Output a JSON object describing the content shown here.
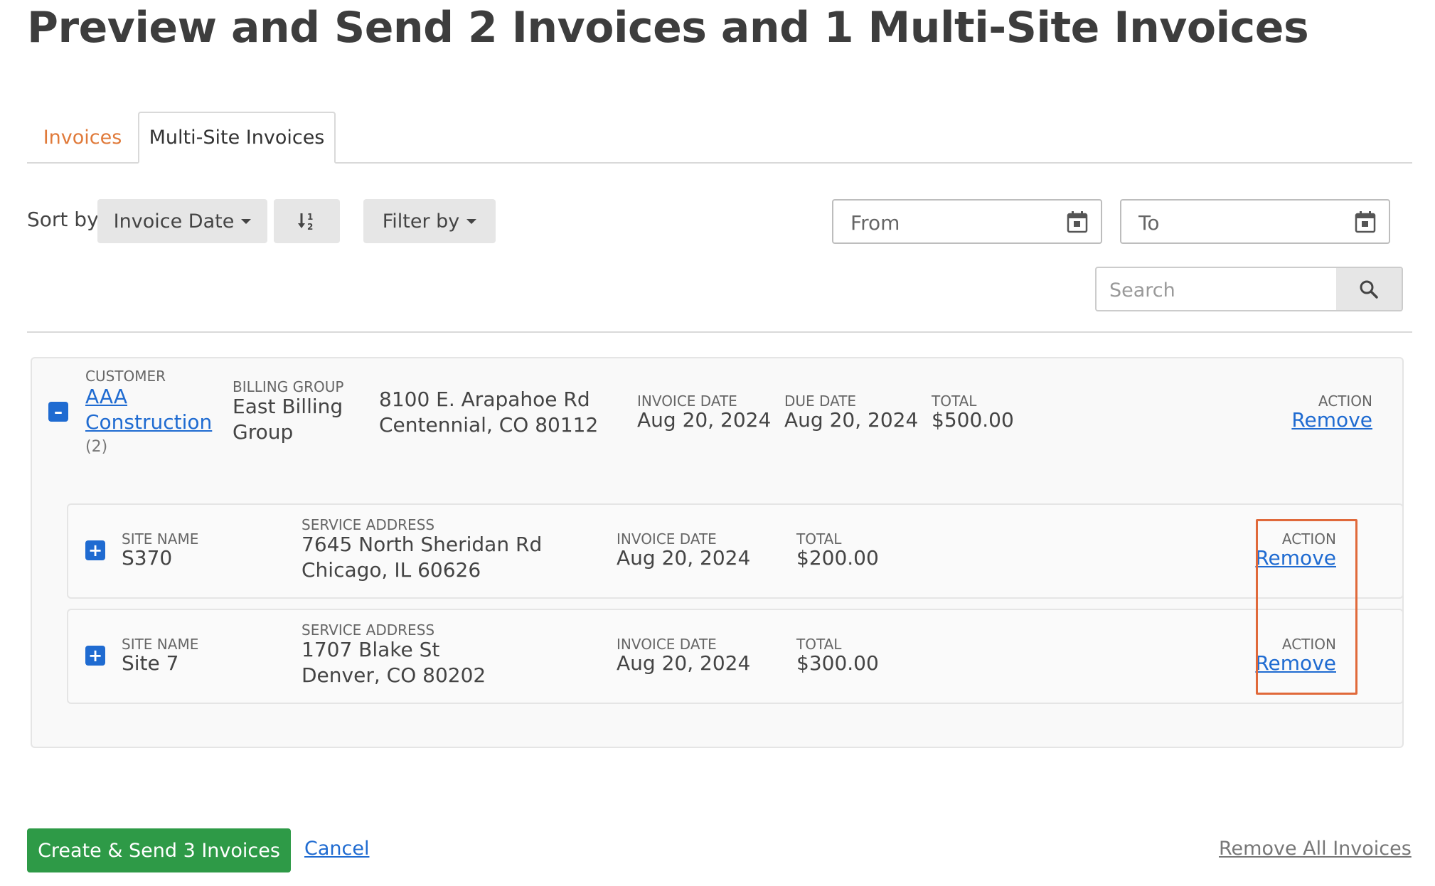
{
  "page": {
    "title": "Preview and Send 2 Invoices and 1 Multi-Site Invoices"
  },
  "tabs": [
    {
      "label": "Invoices",
      "active": false
    },
    {
      "label": "Multi-Site Invoices",
      "active": true
    }
  ],
  "toolbar": {
    "sort_label": "Sort by",
    "sort_value": "Invoice Date",
    "filter_label": "Filter by",
    "from_placeholder": "From",
    "to_placeholder": "To",
    "search_placeholder": "Search"
  },
  "customer": {
    "labels": {
      "customer": "CUSTOMER",
      "billing_group": "BILLING GROUP",
      "invoice_date": "INVOICE DATE",
      "due_date": "DUE DATE",
      "total": "TOTAL",
      "action": "ACTION"
    },
    "name_line1": "AAA",
    "name_line2": "Construction",
    "count": "(2)",
    "billing_group_line1": "East Billing",
    "billing_group_line2": "Group",
    "address_line1": "8100 E. Arapahoe Rd",
    "address_line2": "Centennial, CO 80112",
    "invoice_date": "Aug 20, 2024",
    "due_date": "Aug 20, 2024",
    "total": "$500.00",
    "action": "Remove"
  },
  "sites": {
    "labels": {
      "site_name": "SITE NAME",
      "service_address": "SERVICE ADDRESS",
      "invoice_date": "INVOICE DATE",
      "total": "TOTAL",
      "action": "ACTION"
    },
    "items": [
      {
        "site_name": "S370",
        "address_line1": "7645 North Sheridan Rd",
        "address_line2": "Chicago, IL 60626",
        "invoice_date": "Aug 20, 2024",
        "total": "$200.00",
        "action": "Remove"
      },
      {
        "site_name": "Site 7",
        "address_line1": "1707 Blake St",
        "address_line2": "Denver, CO 80202",
        "invoice_date": "Aug 20, 2024",
        "total": "$300.00",
        "action": "Remove"
      }
    ]
  },
  "footer": {
    "create_label": "Create & Send 3 Invoices",
    "cancel_label": "Cancel",
    "remove_all_label": "Remove All Invoices"
  },
  "colors": {
    "accent_blue": "#1f6bd1",
    "tab_orange": "#e07a3a",
    "create_green": "#2e9a47",
    "highlight_orange": "#e0693a"
  },
  "icons": {
    "sort_direction": "sort-amount-down-icon",
    "calendar": "calendar-icon",
    "search": "search-icon",
    "collapse": "minus-square-icon",
    "expand": "plus-square-icon"
  }
}
